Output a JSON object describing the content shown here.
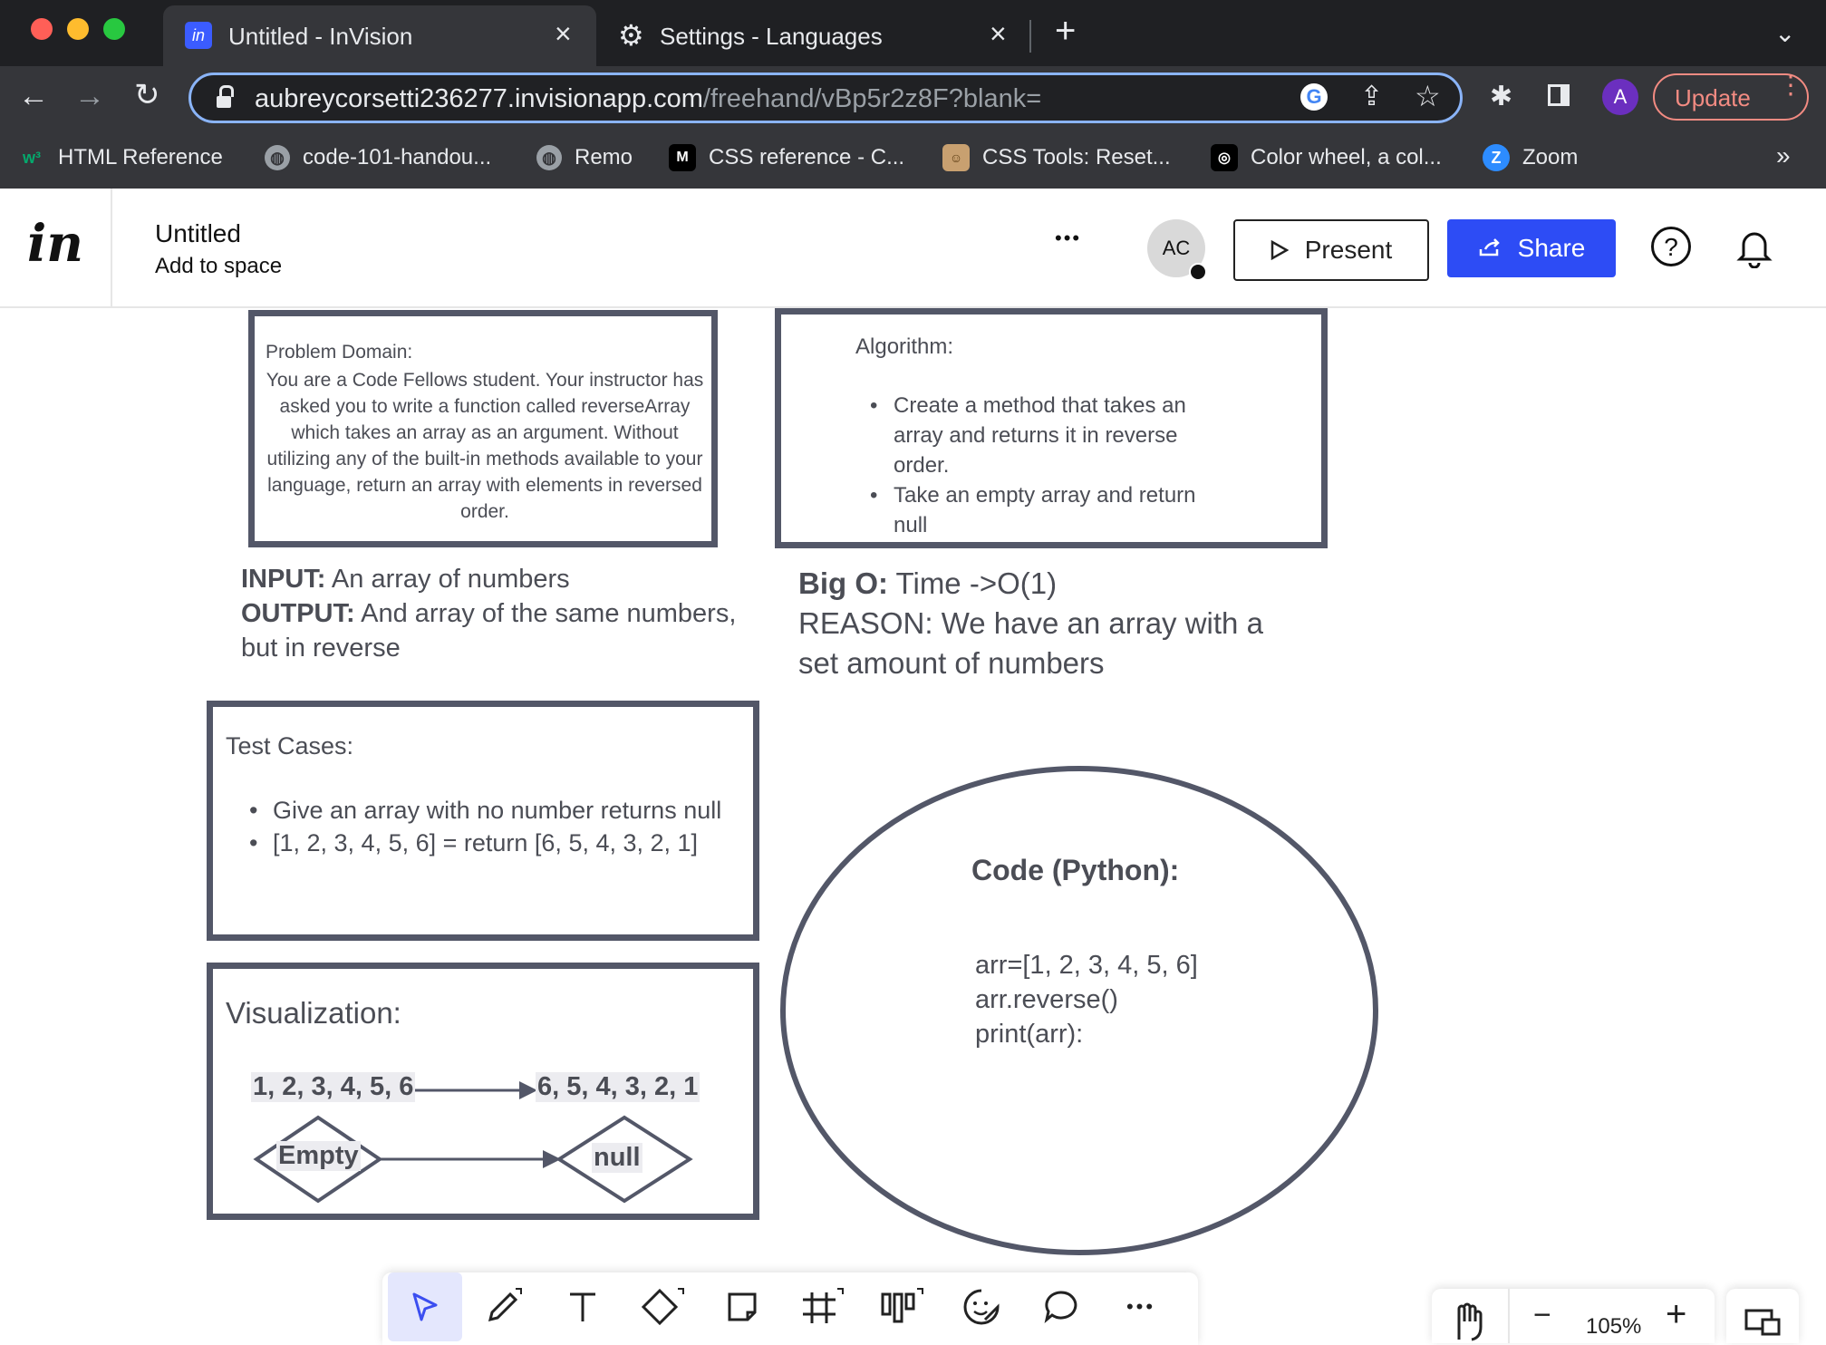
{
  "browser": {
    "tabs": [
      {
        "title": "Untitled - InVision",
        "icon": "invision-icon",
        "active": true
      },
      {
        "title": "Settings - Languages",
        "icon": "gear-icon",
        "active": false
      }
    ],
    "url": {
      "domain": "aubreycorsetti236277.invisionapp.com",
      "path": "/freehand/vBp5r2z8F?blank="
    },
    "profile_initial": "A",
    "update_label": "Update",
    "bookmarks": [
      {
        "label": "HTML Reference",
        "icon": "w3schools-icon"
      },
      {
        "label": "code-101-handou...",
        "icon": "globe-icon"
      },
      {
        "label": "Remo",
        "icon": "globe-icon"
      },
      {
        "label": "CSS reference - C...",
        "icon": "mdn-icon"
      },
      {
        "label": "CSS Tools: Reset...",
        "icon": "meyerweb-icon"
      },
      {
        "label": "Color wheel, a col...",
        "icon": "adobe-color-icon"
      },
      {
        "label": "Zoom",
        "icon": "zoom-icon"
      }
    ],
    "bookmarks_overflow": "»"
  },
  "app": {
    "logo": "in",
    "doc_title": "Untitled",
    "doc_subtitle": "Add to space",
    "more": "•••",
    "avatar_initials": "AC",
    "present_label": "Present",
    "share_label": "Share",
    "help": "?"
  },
  "canvas": {
    "problem": {
      "heading": "Problem Domain:",
      "body": "You are a Code Fellows student. Your instructor has asked you to write a function called reverseArray which takes an array as an argument. Without utilizing any of the built-in methods available to your language, return an array with elements in reversed order."
    },
    "algorithm": {
      "heading": "Algorithm:",
      "items": [
        "Create a method that takes an array and returns it in reverse order.",
        " Take an empty array and return null"
      ]
    },
    "io": {
      "input_label": "INPUT:",
      "input_text": " An array of numbers",
      "output_label": "OUTPUT:",
      "output_text": " And array of the same numbers, but in reverse"
    },
    "bigo": {
      "label": "Big O:",
      "text": " Time ->O(1)",
      "reason": "REASON: We have an array with a set amount of numbers"
    },
    "tests": {
      "heading": "Test Cases:",
      "items": [
        "Give an array with no number returns null",
        "[1, 2, 3, 4, 5, 6] = return [6, 5, 4, 3, 2, 1]"
      ]
    },
    "viz": {
      "heading": "Visualization:",
      "from": "1, 2, 3, 4, 5, 6",
      "to": "6, 5, 4, 3, 2, 1",
      "empty": "Empty",
      "null": "null"
    },
    "code": {
      "heading": "Code (Python):",
      "lines": [
        "arr=[1, 2, 3, 4, 5, 6]",
        "arr.reverse()",
        "print(arr):"
      ]
    }
  },
  "zoom": {
    "level": "105%"
  },
  "colors": {
    "accent": "#2d4cf5",
    "shape_stroke": "#535768",
    "text": "#4b4d55",
    "chrome_dark": "#1f2023",
    "chrome_toolbar": "#35363a",
    "omnibox_focus": "#8ab4f8",
    "update_border": "#f28b82"
  }
}
